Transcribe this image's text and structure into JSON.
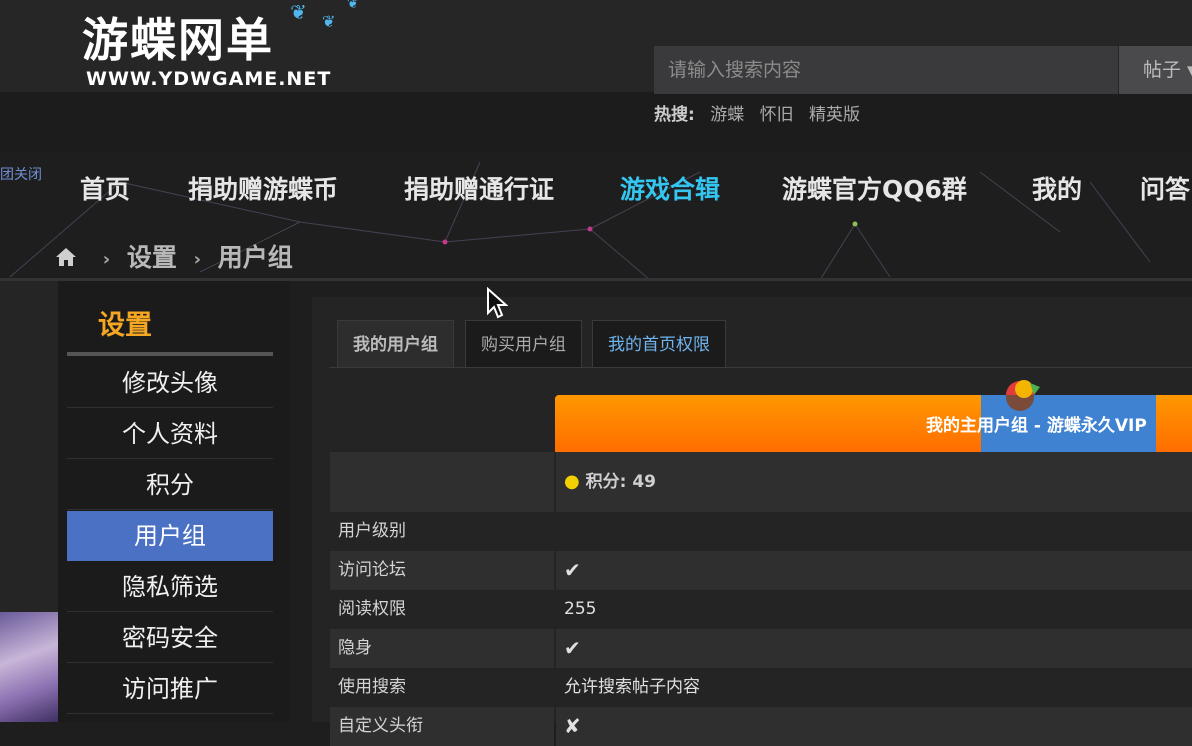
{
  "header": {
    "logo_title": "游蝶网单",
    "logo_subtitle": "WWW.YDWGAME.NET",
    "search_placeholder": "请输入搜索内容",
    "search_type": "帖子",
    "hot_label": "热搜:",
    "hot_keywords": [
      "游蝶",
      "怀旧",
      "精英版"
    ],
    "close_text": "团关闭"
  },
  "nav": {
    "items": [
      "首页",
      "捐助赠游蝶币",
      "捐助赠通行证",
      "游戏合辑",
      "游蝶官方QQ6群",
      "我的",
      "问答"
    ],
    "active_index": 3
  },
  "breadcrumb": [
    "设置",
    "用户组"
  ],
  "sidebar": {
    "title": "设置",
    "items": [
      "修改头像",
      "个人资料",
      "积分",
      "用户组",
      "隐私筛选",
      "密码安全",
      "访问推广"
    ],
    "active_index": 3
  },
  "tabs": [
    "我的用户组",
    "购买用户组",
    "我的首页权限"
  ],
  "banner": {
    "text": "我的主用户组 - 游蝶永久VIP"
  },
  "points": {
    "label": "积分: 49"
  },
  "table": {
    "rows": [
      {
        "key": "用户级别",
        "value": ""
      },
      {
        "key": "访问论坛",
        "value": "✔"
      },
      {
        "key": "阅读权限",
        "value": "255"
      },
      {
        "key": "隐身",
        "value": "✔"
      },
      {
        "key": "使用搜索",
        "value": "允许搜索帖子内容"
      },
      {
        "key": "自定义头衔",
        "value": "✘"
      }
    ]
  },
  "colors": {
    "accent": "#f5a623",
    "nav_active": "#34c6f0",
    "sidebar_active": "#4a71c4",
    "banner_orange": "#ff8a00",
    "banner_highlight": "#3f82d1",
    "check": "#8bc34a"
  }
}
